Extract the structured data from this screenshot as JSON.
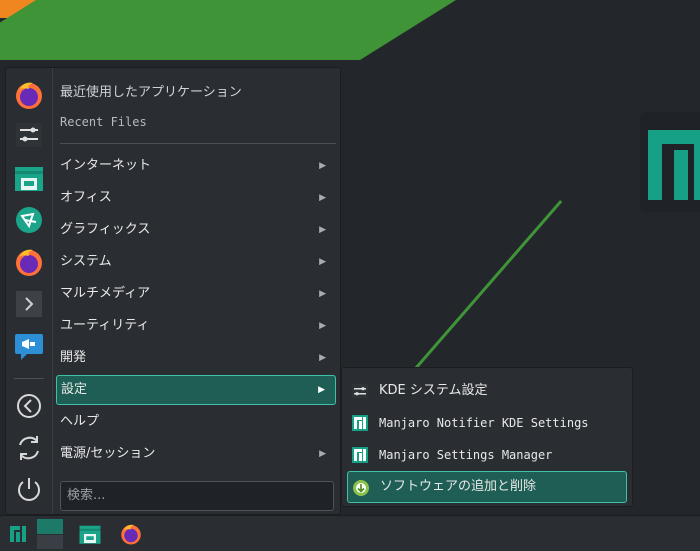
{
  "menu": {
    "recent_apps_label": "最近使用したアプリケーション",
    "recent_files_label": "Recent Files",
    "categories": [
      {
        "label": "インターネット",
        "has_submenu": true
      },
      {
        "label": "オフィス",
        "has_submenu": true
      },
      {
        "label": "グラフィックス",
        "has_submenu": true
      },
      {
        "label": "システム",
        "has_submenu": true
      },
      {
        "label": "マルチメディア",
        "has_submenu": true
      },
      {
        "label": "ユーティリティ",
        "has_submenu": true
      },
      {
        "label": "開発",
        "has_submenu": true
      },
      {
        "label": "設定",
        "has_submenu": true,
        "active": true
      },
      {
        "label": "ヘルプ",
        "has_submenu": false
      },
      {
        "label": "電源/セッション",
        "has_submenu": true
      }
    ],
    "arrow_glyph": "▶",
    "search_placeholder": "検索..."
  },
  "favorites": [
    {
      "icon": "firefox-icon"
    },
    {
      "icon": "system-settings-icon"
    },
    {
      "icon": "file-manager-icon"
    },
    {
      "icon": "kde-connect-icon"
    },
    {
      "icon": "firefox-icon"
    },
    {
      "icon": "terminal-icon"
    },
    {
      "icon": "announcement-icon"
    }
  ],
  "session_actions": [
    {
      "icon": "logout-icon"
    },
    {
      "icon": "restart-icon"
    },
    {
      "icon": "shutdown-icon"
    }
  ],
  "submenu": {
    "items": [
      {
        "label": "KDE システム設定",
        "icon": "system-settings-icon"
      },
      {
        "label": "Manjaro Notifier KDE Settings",
        "icon": "manjaro-notifier-icon"
      },
      {
        "label": "Manjaro Settings Manager",
        "icon": "manjaro-settings-icon"
      },
      {
        "label": "ソフトウェアの追加と削除",
        "icon": "add-remove-software-icon",
        "active": true
      }
    ]
  },
  "taskbar": {
    "items": [
      {
        "icon": "manjaro-menu-icon"
      },
      {
        "icon": "pager-icon"
      },
      {
        "icon": "file-manager-icon"
      },
      {
        "icon": "firefox-icon"
      }
    ]
  },
  "colors": {
    "accent": "#16a085",
    "highlight": "#1e5e54",
    "highlight_border": "#3fc1a7",
    "wallpaper_green": "#3f9437",
    "wallpaper_orange": "#f0861f"
  }
}
